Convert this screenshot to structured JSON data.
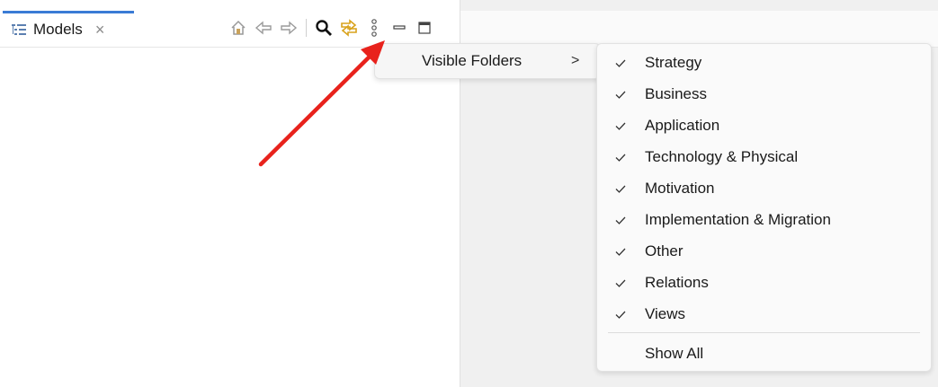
{
  "tab": {
    "title": "Models",
    "close_glyph": "×"
  },
  "toolbar": {
    "icons": [
      "home-icon",
      "back-icon",
      "forward-icon",
      "search-icon",
      "link-icon",
      "more-icon",
      "minimize-icon",
      "maximize-icon"
    ]
  },
  "menu": {
    "visible_folders_label": "Visible Folders",
    "submenu_arrow": ">"
  },
  "submenu": {
    "check_glyph": "✓",
    "items": [
      {
        "label": "Strategy",
        "checked": true
      },
      {
        "label": "Business",
        "checked": true
      },
      {
        "label": "Application",
        "checked": true
      },
      {
        "label": "Technology & Physical",
        "checked": true
      },
      {
        "label": "Motivation",
        "checked": true
      },
      {
        "label": "Implementation & Migration",
        "checked": true
      },
      {
        "label": "Other",
        "checked": true
      },
      {
        "label": "Relations",
        "checked": true
      },
      {
        "label": "Views",
        "checked": true
      }
    ],
    "show_all_label": "Show All"
  },
  "colors": {
    "accent": "#3a7bd5",
    "annotation_arrow": "#e8221c",
    "link_icon": "#d9a21b"
  }
}
